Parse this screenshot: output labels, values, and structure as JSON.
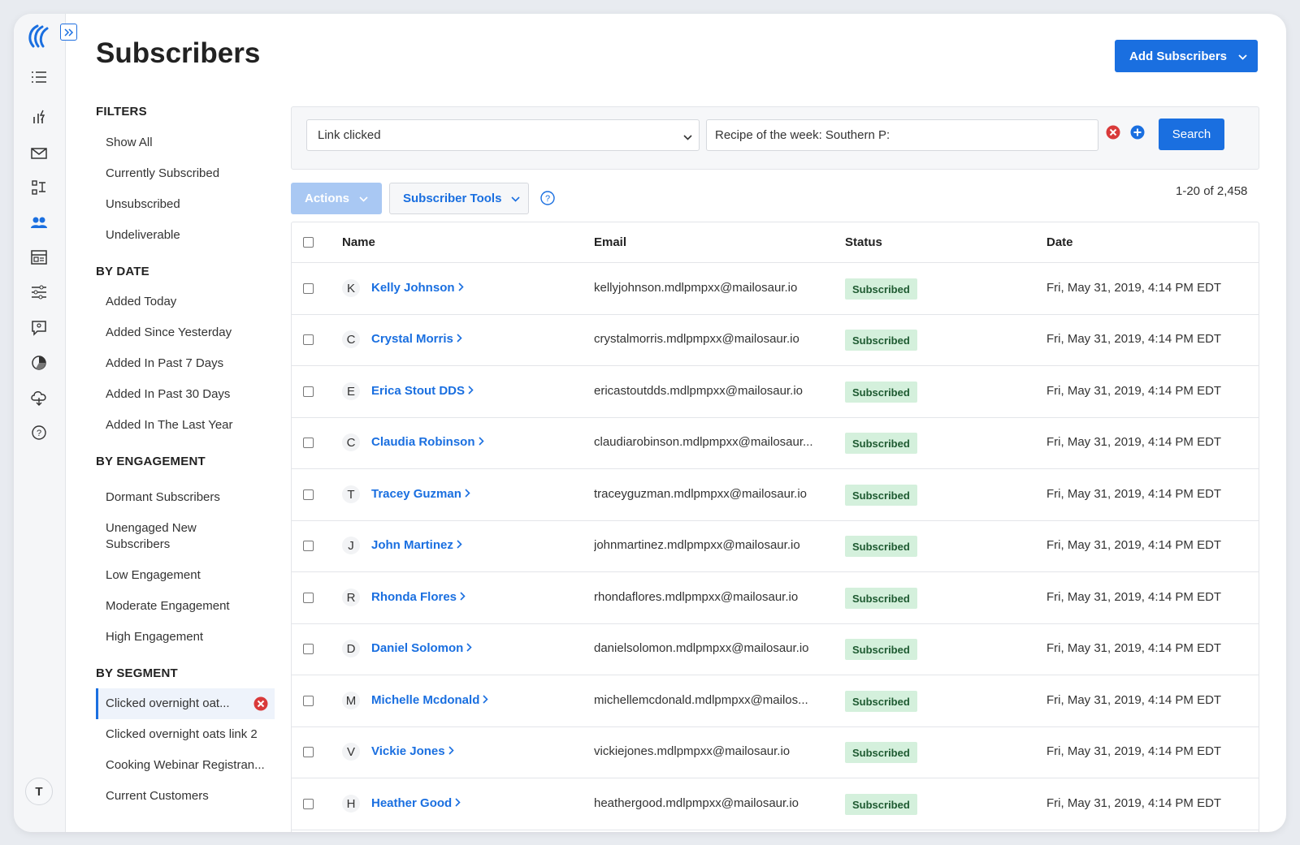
{
  "page": {
    "title": "Subscribers",
    "add_button_label": "Add Subscribers"
  },
  "rail": {
    "icons": [
      "analytics-icon",
      "campaigns-icon",
      "automation-icon",
      "subscribers-icon",
      "forms-icon",
      "settings-icon",
      "feedback-icon",
      "reports-icon",
      "integrations-icon",
      "help-icon"
    ],
    "avatar_initial": "T"
  },
  "filters": {
    "heading": "FILTERS",
    "general": [
      "Show All",
      "Currently Subscribed",
      "Unsubscribed",
      "Undeliverable"
    ],
    "by_date_heading": "BY DATE",
    "by_date": [
      "Added Today",
      "Added Since Yesterday",
      "Added In Past 7 Days",
      "Added In Past 30 Days",
      "Added In The Last Year"
    ],
    "by_engagement_heading": "BY ENGAGEMENT",
    "by_engagement": [
      "Dormant Subscribers",
      "Unengaged New Subscribers",
      "Low Engagement",
      "Moderate Engagement",
      "High Engagement"
    ],
    "by_segment_heading": "BY SEGMENT",
    "by_segment": [
      "Clicked overnight oat...",
      "Clicked overnight oats link 2",
      "Cooking Webinar Registran...",
      "Current Customers"
    ]
  },
  "search": {
    "condition_value": "Link clicked",
    "text_value": "Recipe of the week: Southern P:",
    "button_label": "Search"
  },
  "toolbar": {
    "actions_label": "Actions",
    "tools_label": "Subscriber Tools",
    "pagination": "1-20 of 2,458"
  },
  "table": {
    "columns": [
      "Name",
      "Email",
      "Status",
      "Date"
    ],
    "rows": [
      {
        "initial": "K",
        "name": "Kelly Johnson",
        "email": "kellyjohnson.mdlpmpxx@mailosaur.io",
        "status": "Subscribed",
        "date": "Fri, May 31, 2019, 4:14 PM EDT"
      },
      {
        "initial": "C",
        "name": "Crystal Morris",
        "email": "crystalmorris.mdlpmpxx@mailosaur.io",
        "status": "Subscribed",
        "date": "Fri, May 31, 2019, 4:14 PM EDT"
      },
      {
        "initial": "E",
        "name": "Erica Stout DDS",
        "email": "ericastoutdds.mdlpmpxx@mailosaur.io",
        "status": "Subscribed",
        "date": "Fri, May 31, 2019, 4:14 PM EDT"
      },
      {
        "initial": "C",
        "name": "Claudia Robinson",
        "email": "claudiarobinson.mdlpmpxx@mailosaur...",
        "status": "Subscribed",
        "date": "Fri, May 31, 2019, 4:14 PM EDT"
      },
      {
        "initial": "T",
        "name": "Tracey Guzman",
        "email": "traceyguzman.mdlpmpxx@mailosaur.io",
        "status": "Subscribed",
        "date": "Fri, May 31, 2019, 4:14 PM EDT"
      },
      {
        "initial": "J",
        "name": "John Martinez",
        "email": "johnmartinez.mdlpmpxx@mailosaur.io",
        "status": "Subscribed",
        "date": "Fri, May 31, 2019, 4:14 PM EDT"
      },
      {
        "initial": "R",
        "name": "Rhonda Flores",
        "email": "rhondaflores.mdlpmpxx@mailosaur.io",
        "status": "Subscribed",
        "date": "Fri, May 31, 2019, 4:14 PM EDT"
      },
      {
        "initial": "D",
        "name": "Daniel Solomon",
        "email": "danielsolomon.mdlpmpxx@mailosaur.io",
        "status": "Subscribed",
        "date": "Fri, May 31, 2019, 4:14 PM EDT"
      },
      {
        "initial": "M",
        "name": "Michelle Mcdonald",
        "email": "michellemcdonald.mdlpmpxx@mailos...",
        "status": "Subscribed",
        "date": "Fri, May 31, 2019, 4:14 PM EDT"
      },
      {
        "initial": "V",
        "name": "Vickie Jones",
        "email": "vickiejones.mdlpmpxx@mailosaur.io",
        "status": "Subscribed",
        "date": "Fri, May 31, 2019, 4:14 PM EDT"
      },
      {
        "initial": "H",
        "name": "Heather Good",
        "email": "heathergood.mdlpmpxx@mailosaur.io",
        "status": "Subscribed",
        "date": "Fri, May 31, 2019, 4:14 PM EDT"
      }
    ]
  },
  "colors": {
    "accent": "#1a6fe0",
    "status_bg": "#d4f0dc",
    "status_text": "#1e5a31",
    "danger": "#d93a3a"
  }
}
